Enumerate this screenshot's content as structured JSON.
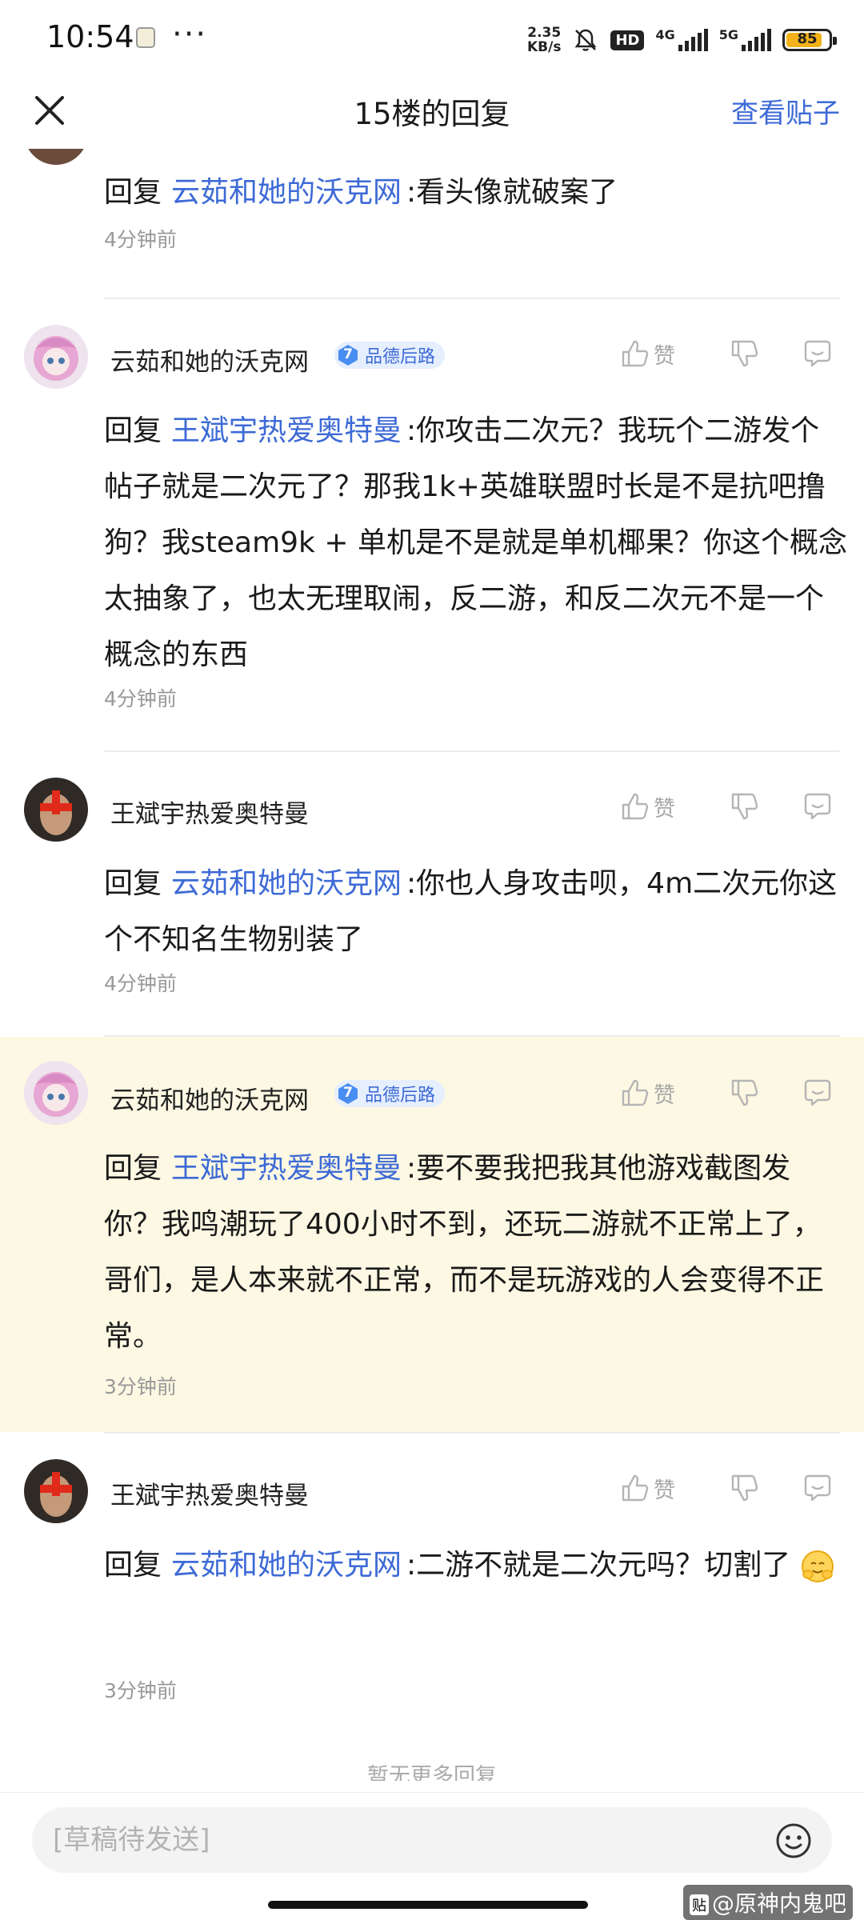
{
  "status_bar": {
    "time": "10:54",
    "more": "···",
    "speed_top": "2.35",
    "speed_bottom": "KB/s",
    "hd": "HD",
    "net1": "4G",
    "net2": "5G",
    "battery": "85",
    "battery_level": 0.85,
    "battery_color": "#f3b21a"
  },
  "header": {
    "title": "15楼的回复",
    "view_post": "查看贴子"
  },
  "comments": [
    {
      "mention_prefix": "回复",
      "mention": "云茹和她的沃克网",
      "text": ":看头像就破案了",
      "time": "4分钟前"
    },
    {
      "user": "云茹和她的沃克网",
      "level": "7",
      "level_name": "品德后路",
      "like": "赞",
      "mention_prefix": "回复",
      "mention": "王斌宇热爱奥特曼",
      "text": ":你攻击二次元？我玩个二游发个帖子就是二次元了？那我1k+英雄联盟时长是不是抗吧撸狗？我steam9k + 单机是不是就是单机椰果？你这个概念太抽象了，也太无理取闹，反二游，和反二次元不是一个概念的东西",
      "time": "4分钟前"
    },
    {
      "user": "王斌宇热爱奥特曼",
      "like": "赞",
      "mention_prefix": "回复",
      "mention": "云茹和她的沃克网",
      "text": ":你也人身攻击呗，4m二次元你这个不知名生物别装了",
      "time": "4分钟前"
    },
    {
      "user": "云茹和她的沃克网",
      "level": "7",
      "level_name": "品德后路",
      "like": "赞",
      "mention_prefix": "回复",
      "mention": "王斌宇热爱奥特曼",
      "text": ":要不要我把我其他游戏截图发你？我鸣潮玩了400小时不到，还玩二游就不正常上了，哥们，是人本来就不正常，而不是玩游戏的人会变得不正常。",
      "time": "3分钟前"
    },
    {
      "user": "王斌宇热爱奥特曼",
      "like": "赞",
      "mention_prefix": "回复",
      "mention": "云茹和她的沃克网",
      "text": ":二游不就是二次元吗？切割了",
      "time": "3分钟前"
    }
  ],
  "no_more": "暂无更多回复",
  "input": {
    "placeholder": "[草稿待发送]"
  },
  "watermark": {
    "icon": "贴",
    "text": "@原神内鬼吧"
  },
  "colors": {
    "accent": "#3d6ad6",
    "highlight_bg": "#fcf8e3",
    "muted": "#999999"
  }
}
